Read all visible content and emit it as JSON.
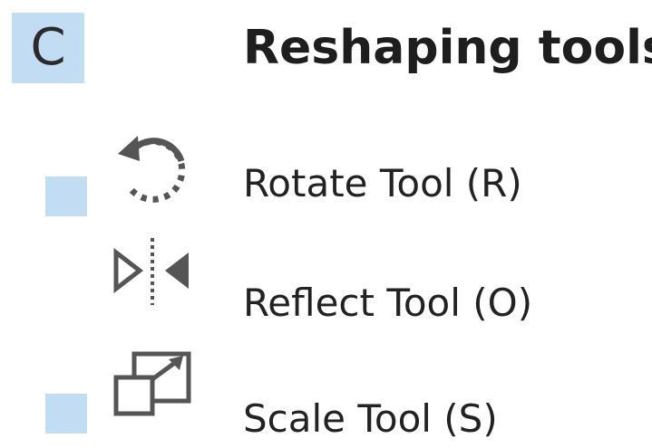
{
  "section": {
    "letter": "C",
    "title": "Reshaping tools"
  },
  "tools": [
    {
      "label": "Rotate Tool (R)",
      "icon": "rotate-icon",
      "marked": true
    },
    {
      "label": "Reflect Tool (O)",
      "icon": "reflect-icon",
      "marked": false
    },
    {
      "label": "Scale Tool (S)",
      "icon": "scale-icon",
      "marked": true
    }
  ],
  "colors": {
    "highlight": "#c2dcf3",
    "icon": "#555555",
    "text": "#222222"
  }
}
